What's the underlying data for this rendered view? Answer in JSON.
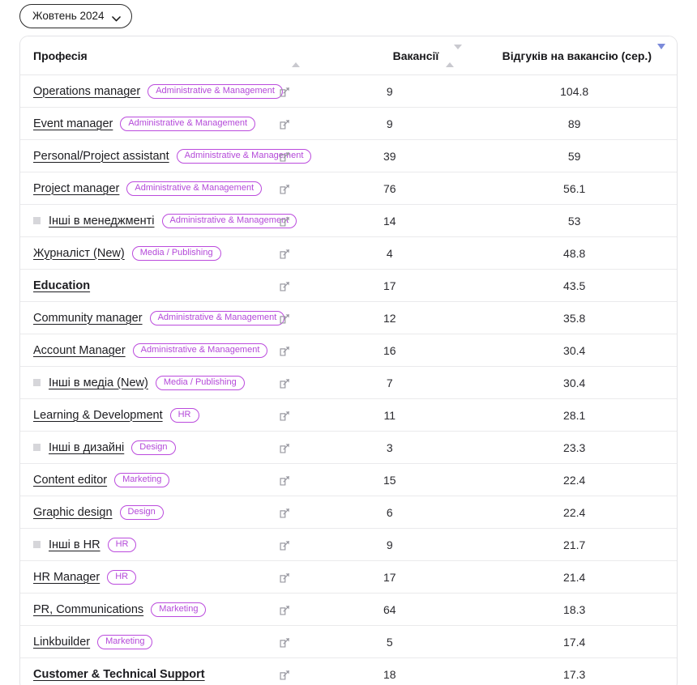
{
  "month_selector": {
    "label": "Жовтень 2024",
    "icon": "chevron-down-icon"
  },
  "table": {
    "columns": [
      {
        "key": "profession",
        "label": "Професія",
        "sort_icon": "sort-ascending-icon",
        "sort_state": "inactive"
      },
      {
        "key": "vacancies",
        "label": "Вакансії",
        "sort_icon": "sort-both-icon",
        "sort_state": "inactive"
      },
      {
        "key": "responses",
        "label": "Відгуків на вакансію (сер.)",
        "sort_icon": "sort-descending-icon",
        "sort_state": "active-desc"
      }
    ],
    "row_link_icon": "external-link-icon",
    "accent_color": "#b449d9",
    "active_sort_color": "#7b8ada",
    "rows": [
      {
        "title": "Operations manager",
        "badge": "Administrative & Management",
        "bullet": false,
        "group": false,
        "vacancies": "9",
        "responses": "104.8"
      },
      {
        "title": "Event manager",
        "badge": "Administrative & Management",
        "bullet": false,
        "group": false,
        "vacancies": "9",
        "responses": "89"
      },
      {
        "title": "Personal/Project assistant",
        "badge": "Administrative & Management",
        "bullet": false,
        "group": false,
        "vacancies": "39",
        "responses": "59"
      },
      {
        "title": "Project manager",
        "badge": "Administrative & Management",
        "bullet": false,
        "group": false,
        "vacancies": "76",
        "responses": "56.1"
      },
      {
        "title": "Інші в менеджменті",
        "badge": "Administrative & Management",
        "bullet": true,
        "group": false,
        "vacancies": "14",
        "responses": "53"
      },
      {
        "title": "Журналіст (New)",
        "badge": "Media / Publishing",
        "bullet": false,
        "group": false,
        "vacancies": "4",
        "responses": "48.8"
      },
      {
        "title": "Education",
        "badge": "",
        "bullet": false,
        "group": true,
        "vacancies": "17",
        "responses": "43.5"
      },
      {
        "title": "Community manager",
        "badge": "Administrative & Management",
        "bullet": false,
        "group": false,
        "vacancies": "12",
        "responses": "35.8"
      },
      {
        "title": "Account Manager",
        "badge": "Administrative & Management",
        "bullet": false,
        "group": false,
        "vacancies": "16",
        "responses": "30.4"
      },
      {
        "title": "Інші в медіа (New)",
        "badge": "Media / Publishing",
        "bullet": true,
        "group": false,
        "vacancies": "7",
        "responses": "30.4"
      },
      {
        "title": "Learning & Development",
        "badge": "HR",
        "bullet": false,
        "group": false,
        "vacancies": "11",
        "responses": "28.1"
      },
      {
        "title": "Інші в дизайні",
        "badge": "Design",
        "bullet": true,
        "group": false,
        "vacancies": "3",
        "responses": "23.3"
      },
      {
        "title": "Content editor",
        "badge": "Marketing",
        "bullet": false,
        "group": false,
        "vacancies": "15",
        "responses": "22.4"
      },
      {
        "title": "Graphic design",
        "badge": "Design",
        "bullet": false,
        "group": false,
        "vacancies": "6",
        "responses": "22.4"
      },
      {
        "title": "Інші в HR",
        "badge": "HR",
        "bullet": true,
        "group": false,
        "vacancies": "9",
        "responses": "21.7"
      },
      {
        "title": "HR Manager",
        "badge": "HR",
        "bullet": false,
        "group": false,
        "vacancies": "17",
        "responses": "21.4"
      },
      {
        "title": "PR, Communications",
        "badge": "Marketing",
        "bullet": false,
        "group": false,
        "vacancies": "64",
        "responses": "18.3"
      },
      {
        "title": "Linkbuilder",
        "badge": "Marketing",
        "bullet": false,
        "group": false,
        "vacancies": "5",
        "responses": "17.4"
      },
      {
        "title": "Customer & Technical Support",
        "badge": "",
        "bullet": false,
        "group": true,
        "vacancies": "18",
        "responses": "17.3"
      }
    ]
  }
}
